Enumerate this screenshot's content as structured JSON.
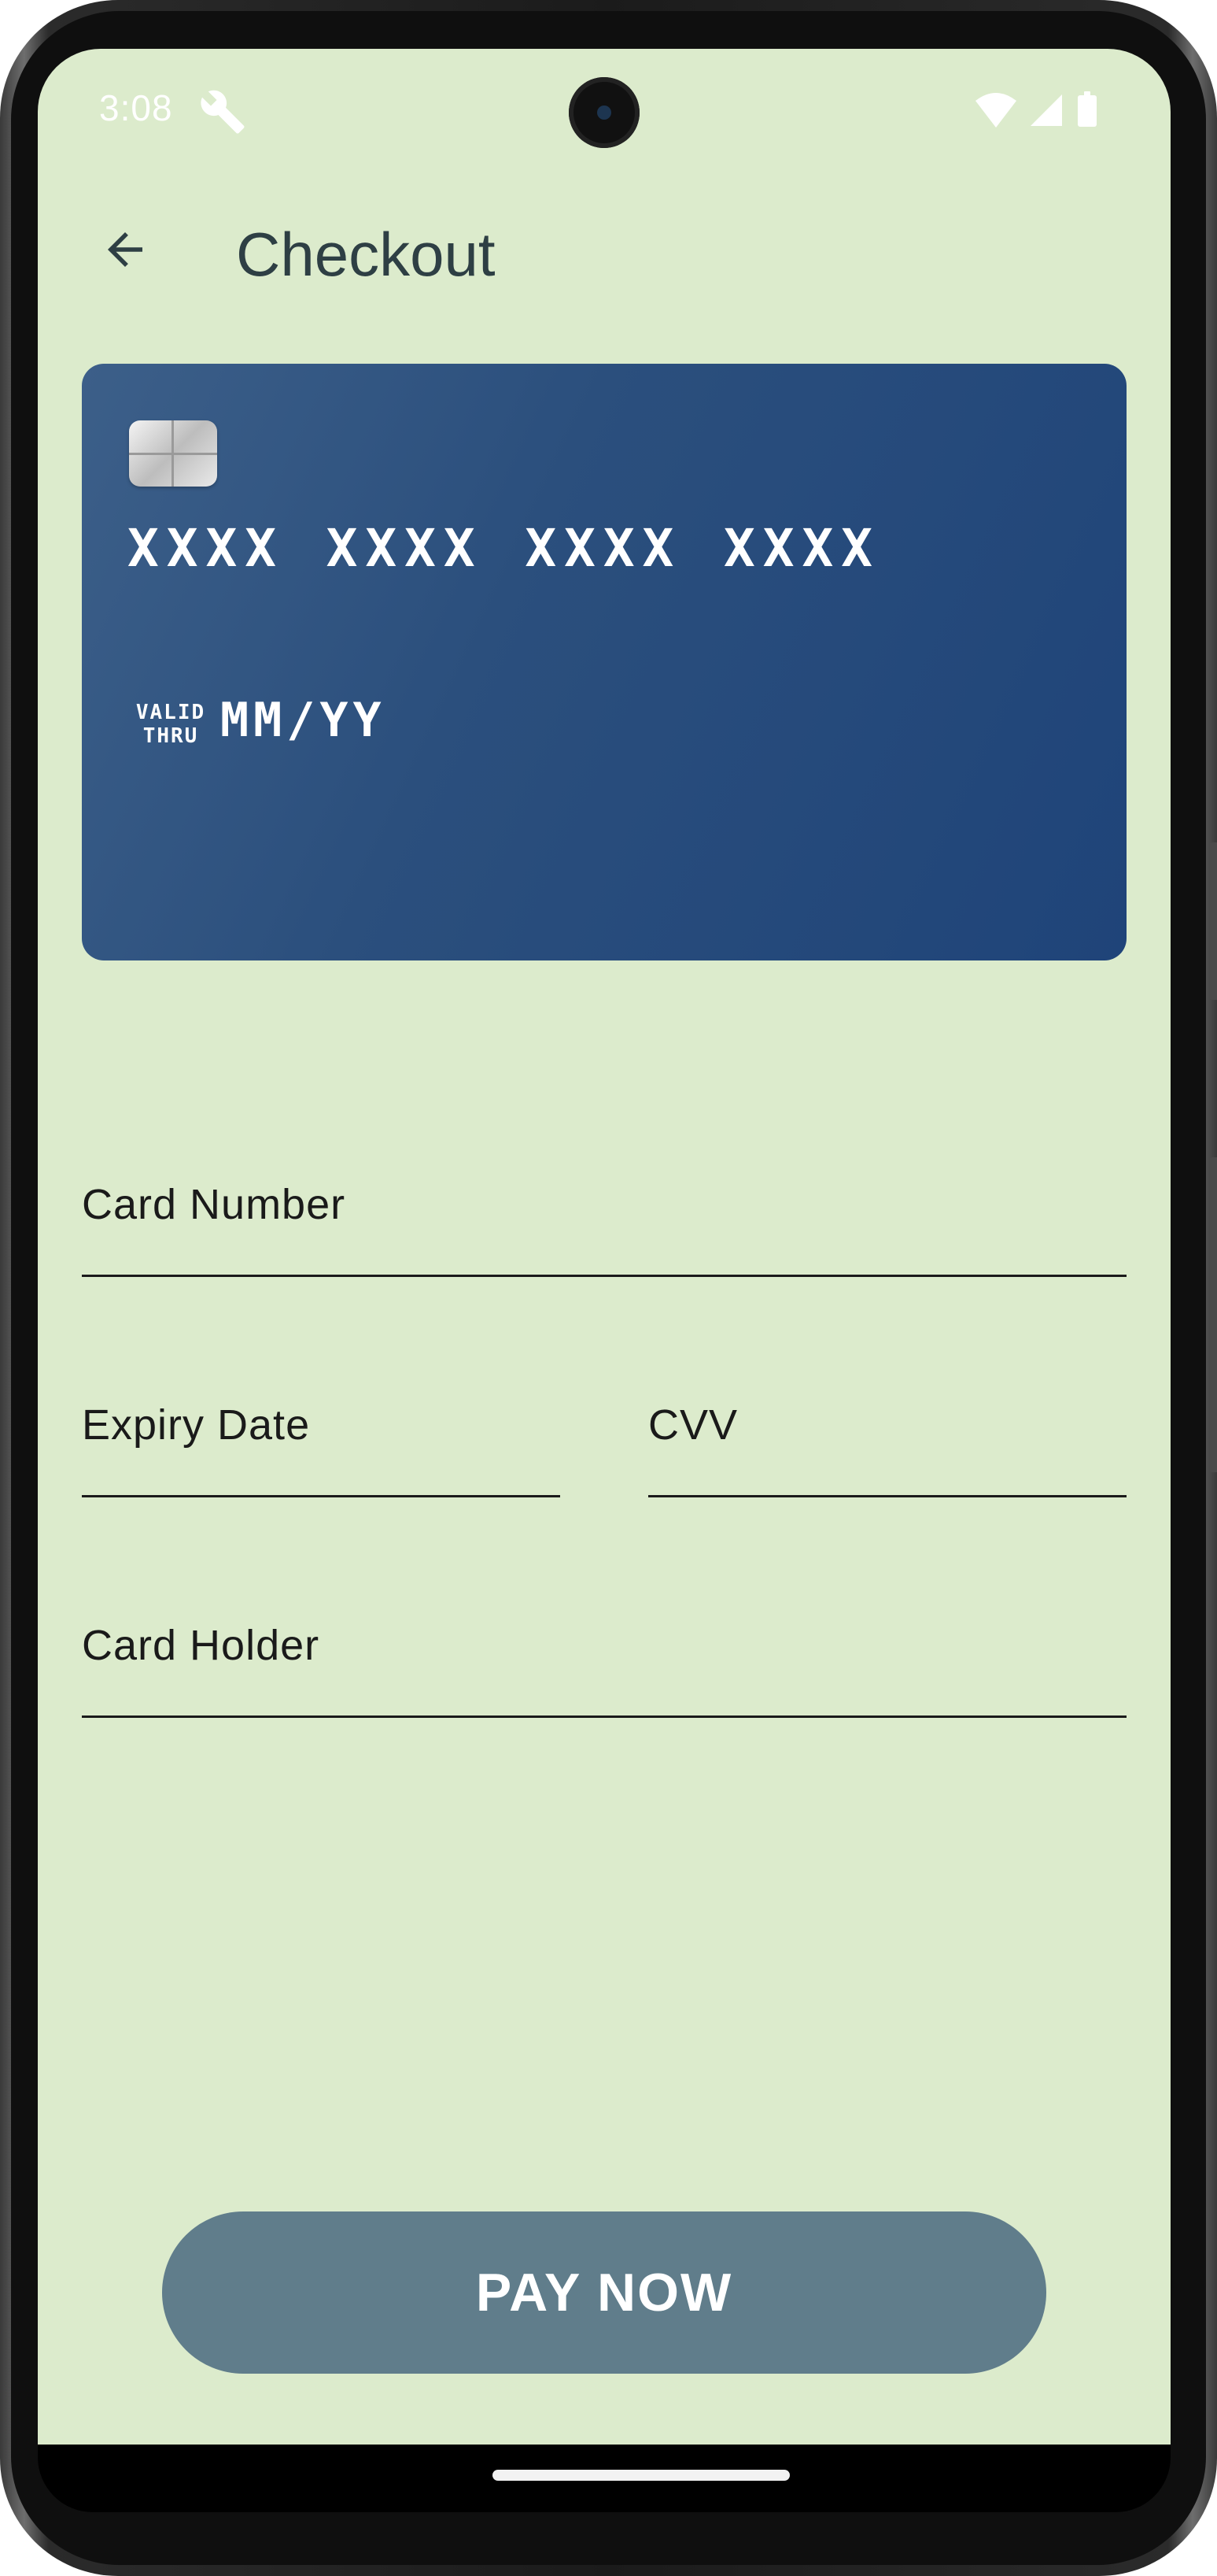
{
  "status_bar": {
    "time": "3:08",
    "icons": [
      "wrench-icon",
      "wifi-icon",
      "signal-icon",
      "battery-icon"
    ]
  },
  "app_bar": {
    "back_icon": "arrow-left-icon",
    "title": "Checkout"
  },
  "card_preview": {
    "number": "XXXX XXXX XXXX XXXX",
    "valid_line1": "VALID",
    "valid_line2": "THRU",
    "expiry": "MM/YY"
  },
  "form": {
    "card_number_label": "Card Number",
    "card_number_value": "",
    "expiry_label": "Expiry Date",
    "expiry_value": "",
    "cvv_label": "CVV",
    "cvv_value": "",
    "holder_label": "Card Holder",
    "holder_value": ""
  },
  "pay_button": {
    "label": "PAY NOW"
  },
  "colors": {
    "background": "#dcebcc",
    "card_gradient_start": "#3c5f89",
    "card_gradient_end": "#1f4479",
    "button": "#607d8b",
    "title": "#2e3f44"
  }
}
